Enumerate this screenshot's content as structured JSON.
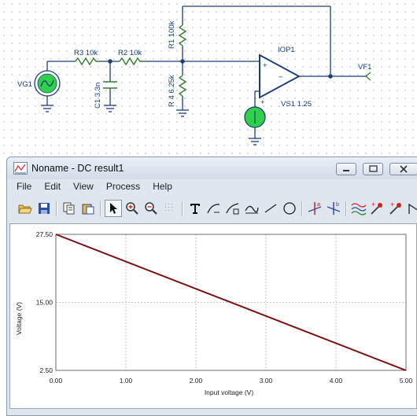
{
  "schematic": {
    "components": {
      "vg1": "VG1",
      "r3": "R3 10k",
      "r2": "R2 10k",
      "c1": "C1 3.3n",
      "r1": "R1 100k",
      "r4": "R 4 6.25k",
      "iop1": "IOP1",
      "vs1": "VS1 1.25",
      "vf1": "VF1"
    },
    "pins": {
      "plus": "+",
      "minus": "−",
      "vs_plus": "+"
    }
  },
  "window": {
    "title": "Noname - DC result1",
    "menu": [
      "File",
      "Edit",
      "View",
      "Process",
      "Help"
    ],
    "toolbar_icons": [
      "open-folder-icon",
      "save-disk-icon",
      "copy-icon",
      "paste-icon",
      "pointer-icon",
      "zoom-in-icon",
      "zoom-out-icon",
      "grid-icon",
      "text-tool-icon",
      "curve-tool-1-icon",
      "curve-tool-2-icon",
      "curve-tool-3-icon",
      "line-tool-icon",
      "circle-tool-icon",
      "cursor-a-icon",
      "cursor-b-icon",
      "wave-icon",
      "marker-1-icon",
      "marker-2-icon",
      "step-icon",
      "scroll-right-icon"
    ]
  },
  "chart_data": {
    "type": "line",
    "title": "",
    "xlabel": "Input voltage (V)",
    "ylabel": "Voltage (V)",
    "xlim": [
      0,
      5
    ],
    "ylim": [
      2.5,
      27.5
    ],
    "x_ticks": [
      "0.00",
      "1.00",
      "2.00",
      "3.00",
      "4.00",
      "5.00"
    ],
    "y_ticks": [
      "27.50",
      "15.00",
      "2.50"
    ],
    "grid": true,
    "series": [
      {
        "x": [
          0,
          5
        ],
        "y": [
          27.5,
          2.5
        ],
        "color": "#7b1010"
      }
    ]
  },
  "colors": {
    "schematic_wire": "#1c3f78",
    "opamp": "#1c3f78",
    "source_fill": "#2fd14a",
    "trace": "#7b1010"
  }
}
